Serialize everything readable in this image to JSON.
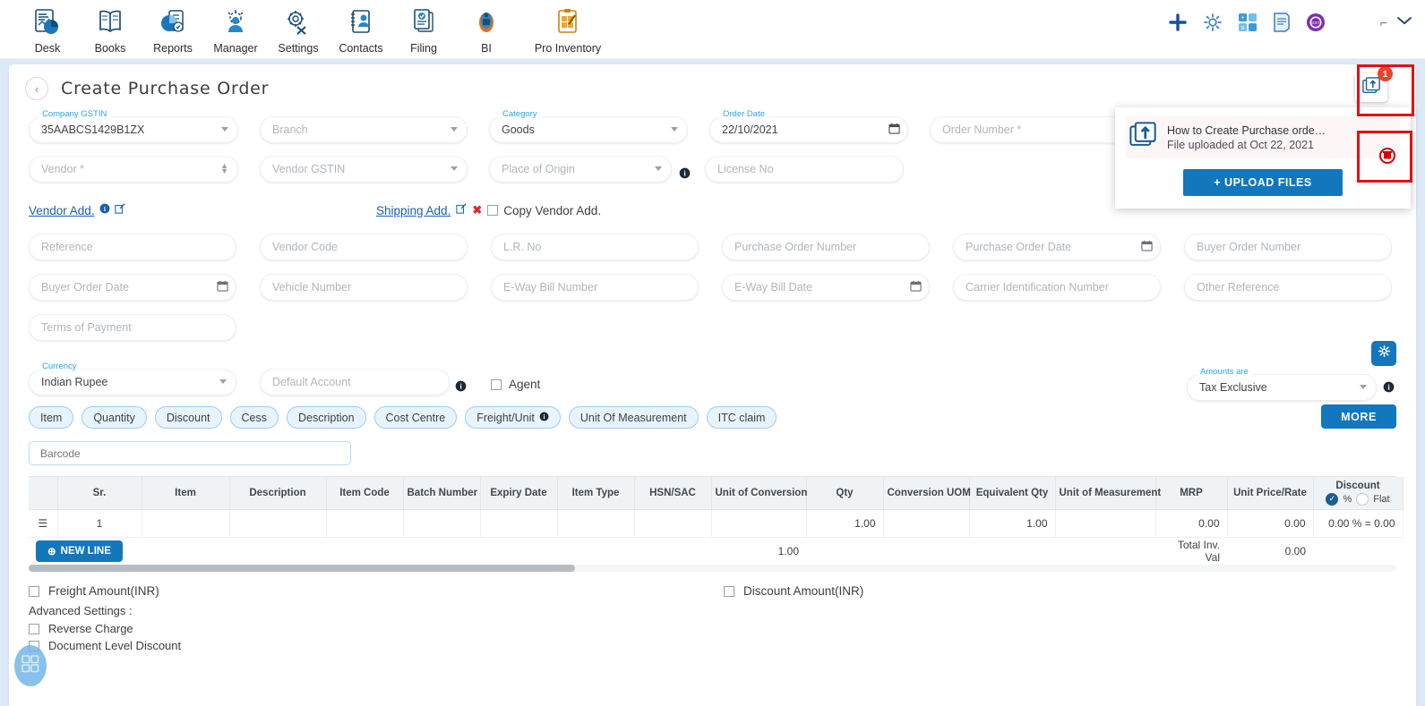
{
  "appbar": {
    "apps": [
      {
        "label": "Desk",
        "icon": "desk-dashboard-icon"
      },
      {
        "label": "Books",
        "icon": "books-icon"
      },
      {
        "label": "Reports",
        "icon": "reports-piechart-icon"
      },
      {
        "label": "Manager",
        "icon": "manager-icon"
      },
      {
        "label": "Settings",
        "icon": "settings-tools-icon"
      },
      {
        "label": "Contacts",
        "icon": "contacts-icon"
      },
      {
        "label": "Filing",
        "icon": "filing-documents-icon"
      },
      {
        "label": "BI",
        "icon": "bi-robot-icon"
      },
      {
        "label": "Pro Inventory",
        "icon": "pro-inventory-clipboard-icon"
      }
    ],
    "actions": [
      {
        "name": "add-icon"
      },
      {
        "name": "gear-icon"
      },
      {
        "name": "apps-grid-icon"
      },
      {
        "name": "notes-icon"
      },
      {
        "name": "gstin-badge-icon"
      }
    ],
    "user_chevron": "chevron-down-icon"
  },
  "header": {
    "back_icon": "chevron-left-icon",
    "title": "Create Purchase Order"
  },
  "notification": {
    "badge_count": "1",
    "upload_fab_icon": "upload-file-icon",
    "item_icon": "upload-file-icon",
    "item_title": "How to Create Purchase orde…",
    "item_subtitle": "File uploaded at Oct 22, 2021",
    "delete_icon": "delete-icon",
    "upload_button": "+ UPLOAD FILES"
  },
  "form": {
    "row1": [
      {
        "label": "Company GSTIN",
        "value": "35AABCS1429B1ZX",
        "placeholder": "",
        "type": "select"
      },
      {
        "label": "",
        "value": "",
        "placeholder": "Branch",
        "type": "select"
      },
      {
        "label": "Category",
        "value": "Goods",
        "placeholder": "",
        "type": "select"
      },
      {
        "label": "Order Date",
        "value": "22/10/2021",
        "placeholder": "",
        "type": "date"
      },
      {
        "label": "",
        "value": "",
        "placeholder": "Order Number *",
        "type": "text"
      }
    ],
    "row2": [
      {
        "label": "",
        "value": "",
        "placeholder": "Vendor *",
        "type": "spinner"
      },
      {
        "label": "",
        "value": "",
        "placeholder": "Vendor GSTIN",
        "type": "select"
      },
      {
        "label": "",
        "value": "",
        "placeholder": "Place of Origin",
        "type": "select-info"
      },
      {
        "label": "",
        "value": "",
        "placeholder": "License No",
        "type": "text"
      }
    ],
    "address": {
      "vendor_link": "Vendor Add.",
      "vendor_info_icon": "info-icon",
      "vendor_edit_icon": "edit-icon",
      "shipping_link": "Shipping Add.",
      "shipping_edit_icon": "edit-icon",
      "shipping_clear_icon": "clear-x-icon",
      "copy_checkbox_label": "Copy Vendor Add."
    },
    "row3": [
      {
        "placeholder": "Reference",
        "type": "text"
      },
      {
        "placeholder": "Vendor Code",
        "type": "text"
      },
      {
        "placeholder": "L.R. No",
        "type": "text"
      },
      {
        "placeholder": "Purchase Order Number",
        "type": "text"
      },
      {
        "placeholder": "Purchase Order Date",
        "type": "date"
      },
      {
        "placeholder": "Buyer Order Number",
        "type": "text"
      }
    ],
    "row4": [
      {
        "placeholder": "Buyer Order Date",
        "type": "date"
      },
      {
        "placeholder": "Vehicle Number",
        "type": "text"
      },
      {
        "placeholder": "E-Way Bill Number",
        "type": "text"
      },
      {
        "placeholder": "E-Way Bill Date",
        "type": "date"
      },
      {
        "placeholder": "Carrier Identification Number",
        "type": "text"
      },
      {
        "placeholder": "Other Reference",
        "type": "text"
      }
    ],
    "row5": [
      {
        "placeholder": "Terms of Payment",
        "type": "text"
      }
    ],
    "currency": {
      "label": "Currency",
      "value": "Indian Rupee",
      "default_account_placeholder": "Default Account",
      "default_account_info_icon": "info-icon",
      "agent_label": "Agent",
      "gear_fab_icon": "gear-icon",
      "amounts_label": "Amounts are",
      "amounts_value": "Tax Exclusive",
      "amounts_info_icon": "info-icon"
    }
  },
  "chips": [
    {
      "label": "Item"
    },
    {
      "label": "Quantity"
    },
    {
      "label": "Discount"
    },
    {
      "label": "Cess"
    },
    {
      "label": "Description"
    },
    {
      "label": "Cost Centre"
    },
    {
      "label": "Freight/Unit",
      "info_icon": "info-icon"
    },
    {
      "label": "Unit Of Measurement"
    },
    {
      "label": "ITC claim"
    }
  ],
  "more_button": "MORE",
  "barcode": {
    "placeholder": "Barcode"
  },
  "table": {
    "columns": [
      "",
      "Sr.",
      "Item",
      "Description",
      "Item Code",
      "Batch Number",
      "Expiry Date",
      "Item Type",
      "HSN/SAC",
      "Unit of Conversion",
      "Qty",
      "Conversion UOM",
      "Equivalent Qty",
      "Unit of Measurement",
      "MRP",
      "Unit Price/Rate",
      "Discount"
    ],
    "discount_header": {
      "title": "Discount",
      "percent_label": "%",
      "flat_label": "Flat",
      "selected": "%"
    },
    "rows": [
      {
        "handle_icon": "drag-handle-icon",
        "sr": "1",
        "item": "",
        "description": "",
        "item_code": "",
        "batch_number": "",
        "expiry_date": "",
        "item_type": "",
        "hsn_sac": "",
        "unit_of_conversion": "",
        "qty": "1.00",
        "conversion_uom": "",
        "equivalent_qty": "1.00",
        "unit_of_measurement": "",
        "mrp": "0.00",
        "unit_price_rate": "0.00",
        "discount": "0.00 % = 0.00"
      }
    ],
    "totals": {
      "qty": "1.00",
      "label": "Total Inv. Val",
      "value": "0.00"
    },
    "new_line_button": "NEW LINE",
    "new_line_icon": "plus-circle-icon"
  },
  "bottom": {
    "freight_label": "Freight Amount(INR)",
    "discount_label": "Discount Amount(INR)",
    "advanced_title": "Advanced Settings :",
    "reverse_charge_label": "Reverse Charge",
    "document_level_discount_label": "Document Level Discount",
    "fab_icon": "apps-grid-icon"
  },
  "colors": {
    "accent_blue": "#1277bc",
    "label_blue": "#26a5e8",
    "link_blue": "#1a5fb4",
    "page_bg": "#dce9f7",
    "annotation_red": "#e51010",
    "badge_red": "#e8442a"
  }
}
